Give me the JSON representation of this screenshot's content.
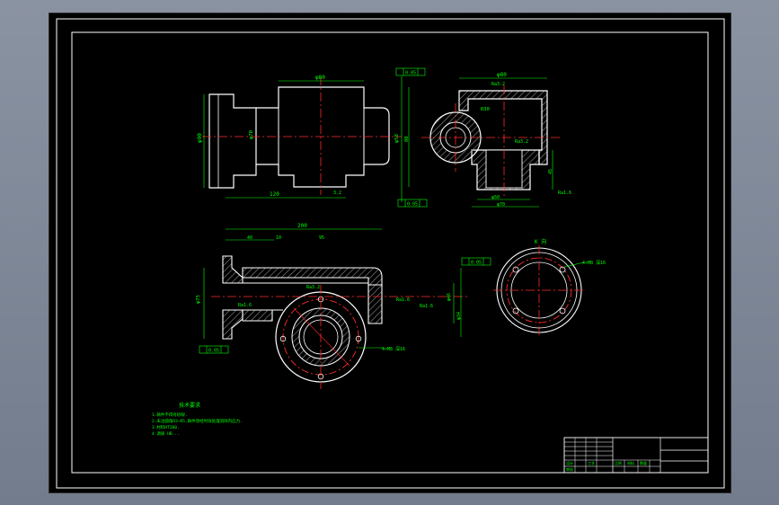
{
  "colors": {
    "background": "#000000",
    "frame": "#ffffff",
    "dimension": "#00ff00",
    "centerline": "#ff2a2a",
    "hatch": "#8f8f8f",
    "outer_bg": "#7f8a99"
  },
  "views": {
    "front": {
      "dim_top": "φ80",
      "dim_left": "φ90",
      "dim_inner": "φ70",
      "dim_bottom": "120",
      "dim_right": "φ58",
      "dim_far_right": "80",
      "gdt_top": "0.05",
      "gdt_bottom": "0.05",
      "roughness": "3.2"
    },
    "side": {
      "dim_top": "φ80",
      "dim_bottom": "φ50",
      "dim_base": "φ70",
      "radius_label": "R30",
      "roughness_a": "Ra3.2",
      "roughness_b": "Ra3.2",
      "roughness_c": "Ra1.6",
      "dim_right": "45"
    },
    "section": {
      "dim_overall": "200",
      "dim_a": "40",
      "dim_b": "10",
      "dim_c": "95",
      "dim_left": "φ75",
      "gdt_top": "0.05",
      "gdt_bottom": "0.05",
      "roughness_a": "Ra3.2",
      "roughness_b": "Ra1.6",
      "roughness_c": "Ra1.6",
      "roughness_d": "Ra1.6",
      "dim_right_a": "φ46",
      "dim_right_b": "φ34",
      "bolt_label": "4×M8 深16"
    },
    "detail": {
      "label": "K 向",
      "bolt_label": "4×M8 深16"
    }
  },
  "notes": {
    "title": "技术要求",
    "line1": "1.铸件不得有砂眼.",
    "line2": "2.未注圆角R3~R5,铸件须经时效处理消除内应力.",
    "line3": "3.材料HT200.",
    "line4": "4.调质 HB..."
  },
  "title_block": {
    "row_a": "设计",
    "row_b": "审核",
    "row_c": "工艺",
    "col_a": "比例",
    "col_b": "材料",
    "col_c": "数量"
  }
}
